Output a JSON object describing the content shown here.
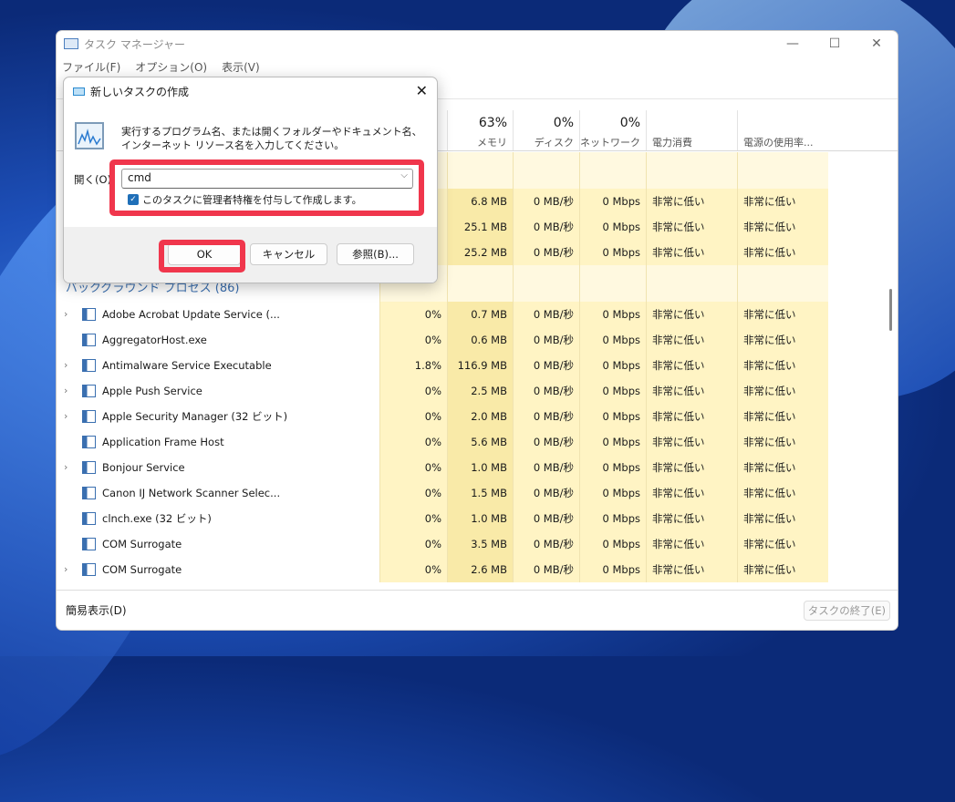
{
  "window": {
    "title": "タスク マネージャー",
    "menu": [
      "ファイル(F)",
      "オプション(O)",
      "表示(V)"
    ],
    "controls": [
      "—",
      "☐",
      "✕"
    ]
  },
  "columns": [
    {
      "pct": "",
      "label": ""
    },
    {
      "pct": "63%",
      "label": "メモリ"
    },
    {
      "pct": "0%",
      "label": "ディスク"
    },
    {
      "pct": "0%",
      "label": "ネットワーク"
    },
    {
      "pct": "",
      "label": "電力消費"
    },
    {
      "pct": "",
      "label": "電源の使用率..."
    }
  ],
  "top_rows": [
    {
      "cpu": "",
      "mem": "6.8 MB",
      "disk": "0 MB/秒",
      "net": "0 Mbps",
      "power": "非常に低い",
      "trend": "非常に低い"
    },
    {
      "cpu": "",
      "mem": "25.1 MB",
      "disk": "0 MB/秒",
      "net": "0 Mbps",
      "power": "非常に低い",
      "trend": "非常に低い"
    },
    {
      "cpu": "",
      "mem": "25.2 MB",
      "disk": "0 MB/秒",
      "net": "0 Mbps",
      "power": "非常に低い",
      "trend": "非常に低い"
    }
  ],
  "group_label": "バックグラウンド プロセス (86)",
  "processes": [
    {
      "name": "Adobe Acrobat Update Service (...",
      "exp": true,
      "cpu": "0%",
      "mem": "0.7 MB",
      "disk": "0 MB/秒",
      "net": "0 Mbps",
      "power": "非常に低い",
      "trend": "非常に低い"
    },
    {
      "name": "AggregatorHost.exe",
      "exp": false,
      "cpu": "0%",
      "mem": "0.6 MB",
      "disk": "0 MB/秒",
      "net": "0 Mbps",
      "power": "非常に低い",
      "trend": "非常に低い"
    },
    {
      "name": "Antimalware Service Executable",
      "exp": true,
      "cpu": "1.8%",
      "mem": "116.9 MB",
      "disk": "0 MB/秒",
      "net": "0 Mbps",
      "power": "非常に低い",
      "trend": "非常に低い"
    },
    {
      "name": "Apple Push Service",
      "exp": true,
      "cpu": "0%",
      "mem": "2.5 MB",
      "disk": "0 MB/秒",
      "net": "0 Mbps",
      "power": "非常に低い",
      "trend": "非常に低い"
    },
    {
      "name": "Apple Security Manager (32 ビット)",
      "exp": true,
      "cpu": "0%",
      "mem": "2.0 MB",
      "disk": "0 MB/秒",
      "net": "0 Mbps",
      "power": "非常に低い",
      "trend": "非常に低い"
    },
    {
      "name": "Application Frame Host",
      "exp": false,
      "cpu": "0%",
      "mem": "5.6 MB",
      "disk": "0 MB/秒",
      "net": "0 Mbps",
      "power": "非常に低い",
      "trend": "非常に低い"
    },
    {
      "name": "Bonjour Service",
      "exp": true,
      "cpu": "0%",
      "mem": "1.0 MB",
      "disk": "0 MB/秒",
      "net": "0 Mbps",
      "power": "非常に低い",
      "trend": "非常に低い"
    },
    {
      "name": "Canon IJ Network Scanner Selec...",
      "exp": false,
      "cpu": "0%",
      "mem": "1.5 MB",
      "disk": "0 MB/秒",
      "net": "0 Mbps",
      "power": "非常に低い",
      "trend": "非常に低い"
    },
    {
      "name": "clnch.exe (32 ビット)",
      "exp": false,
      "cpu": "0%",
      "mem": "1.0 MB",
      "disk": "0 MB/秒",
      "net": "0 Mbps",
      "power": "非常に低い",
      "trend": "非常に低い"
    },
    {
      "name": "COM Surrogate",
      "exp": false,
      "cpu": "0%",
      "mem": "3.5 MB",
      "disk": "0 MB/秒",
      "net": "0 Mbps",
      "power": "非常に低い",
      "trend": "非常に低い"
    },
    {
      "name": "COM Surrogate",
      "exp": true,
      "cpu": "0%",
      "mem": "2.6 MB",
      "disk": "0 MB/秒",
      "net": "0 Mbps",
      "power": "非常に低い",
      "trend": "非常に低い"
    }
  ],
  "footer": {
    "simple": "簡易表示(D)",
    "end_task": "タスクの終了(E)"
  },
  "dialog": {
    "title": "新しいタスクの作成",
    "close": "✕",
    "description": "実行するプログラム名、または開くフォルダーやドキュメント名、インターネット リソース名を入力してください。",
    "open_label": "開く(O):",
    "input_value": "cmd",
    "admin_checkbox": "このタスクに管理者特権を付与して作成します。",
    "admin_checked": true,
    "ok": "OK",
    "cancel": "キャンセル",
    "browse": "参照(B)..."
  },
  "colors": {
    "highlight": "#f0364c",
    "cell": "#fff4c4"
  }
}
